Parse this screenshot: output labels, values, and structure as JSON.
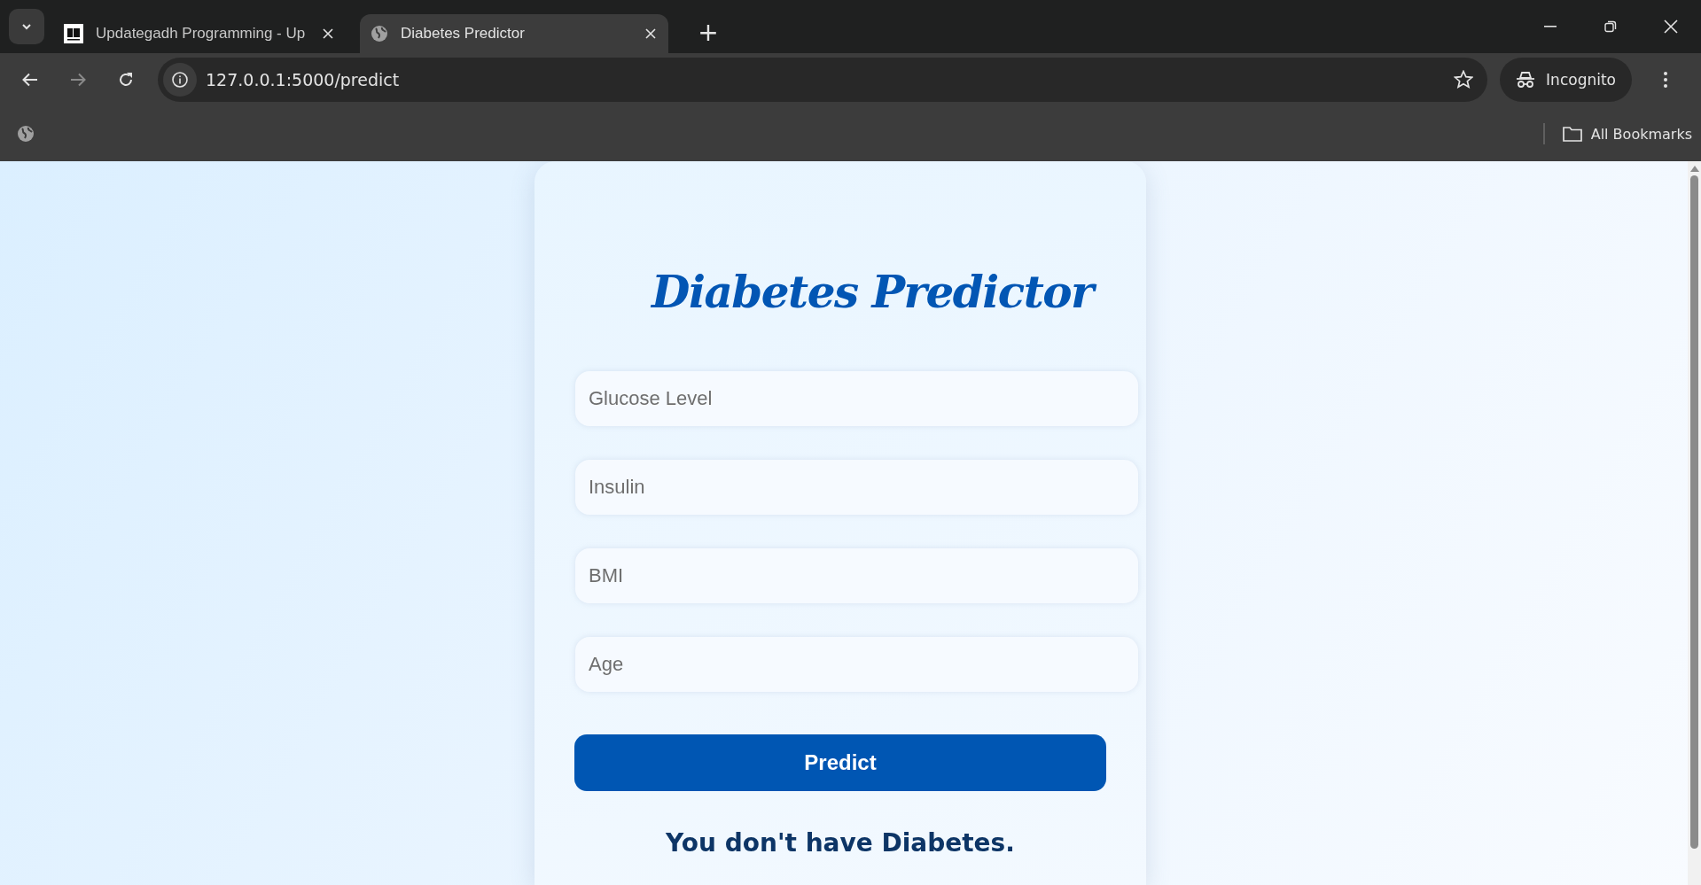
{
  "browser": {
    "tabs": [
      {
        "title": "Updategadh Programming - Up",
        "selected": false
      },
      {
        "title": "Diabetes Predictor",
        "selected": true
      }
    ],
    "new_tab": "+",
    "address": "127.0.0.1:5000/predict",
    "profile": "Incognito",
    "bookmarks_label": "All Bookmarks"
  },
  "form": {
    "title": "Diabetes Predictor",
    "fields": [
      {
        "placeholder": "Glucose Level"
      },
      {
        "placeholder": "Insulin"
      },
      {
        "placeholder": "BMI"
      },
      {
        "placeholder": "Age"
      }
    ],
    "button": "Predict",
    "result": "You don't have Diabetes."
  }
}
